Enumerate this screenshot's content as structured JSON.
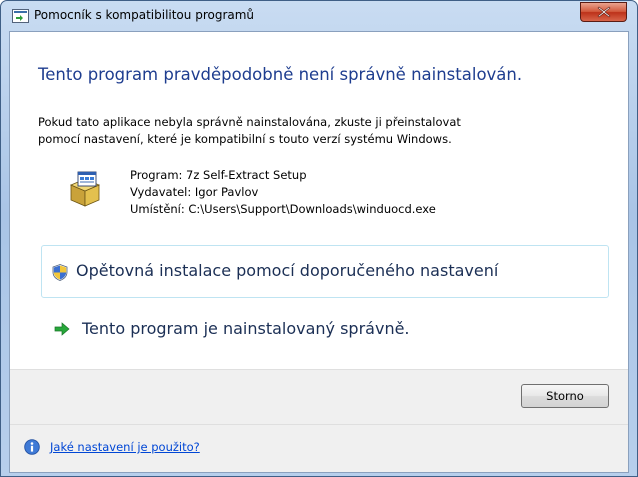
{
  "window": {
    "title": "Pomocník s kompatibilitou programů"
  },
  "heading": "Tento program pravděpodobně není správně nainstalován.",
  "description": [
    "Pokud tato aplikace nebyla správně nainstalována, zkuste ji přeinstalovat",
    "pomocí nastavení, které je kompatibilní s touto verzí systému Windows."
  ],
  "program_info": {
    "program": "Program: 7z Self-Extract Setup",
    "publisher": "Vydavatel: Igor Pavlov",
    "location": "Umístění: C:\\Users\\Support\\Downloads\\winduocd.exe"
  },
  "options": {
    "reinstall": "Opětovná instalace pomocí doporučeného nastavení",
    "installed_ok": "Tento program je nainstalovaný správně."
  },
  "buttons": {
    "cancel": "Storno"
  },
  "help": {
    "link": "Jaké nastavení je použito?"
  },
  "icons": {
    "title": "program-window-icon",
    "app": "installer-package-icon",
    "shield": "uac-shield-icon",
    "arrow": "green-arrow-icon",
    "help": "info-icon",
    "close": "close-icon"
  },
  "colors": {
    "heading": "#1e3d8f",
    "link": "#0046d5",
    "close_button": "#c94a2e",
    "option_border": "#bfe4f2"
  }
}
